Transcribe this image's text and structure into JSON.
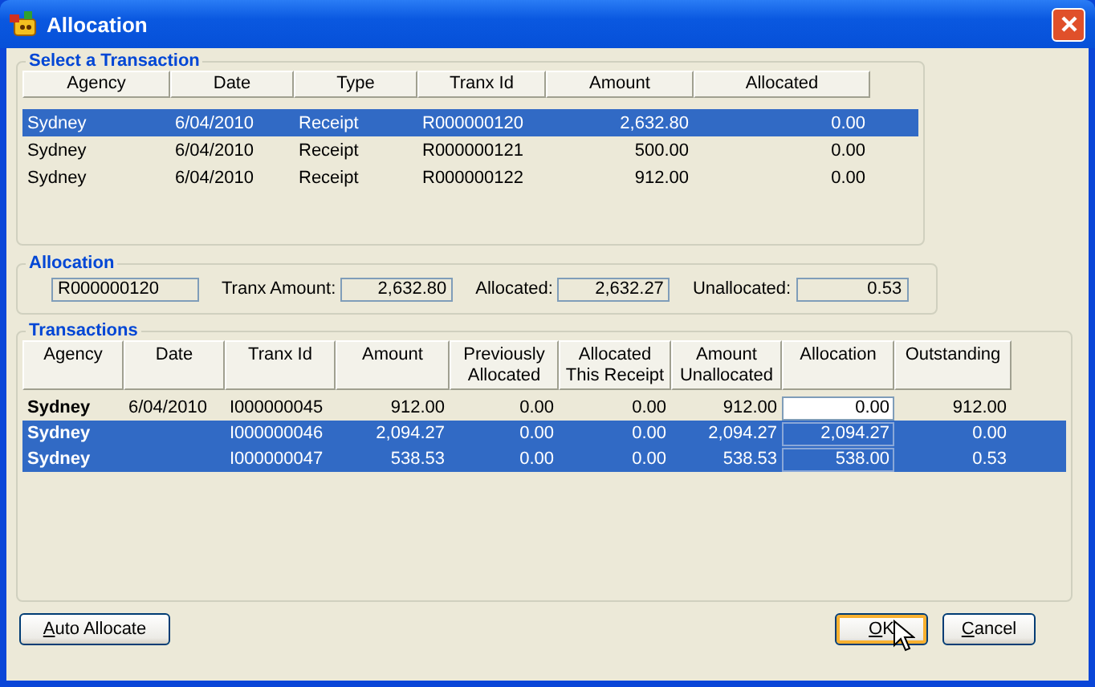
{
  "window": {
    "title": "Allocation"
  },
  "select_transaction": {
    "title": "Select a Transaction",
    "columns": [
      "Agency",
      "Date",
      "Type",
      "Tranx Id",
      "Amount",
      "Allocated"
    ],
    "rows": [
      {
        "cells": [
          "Sydney",
          "6/04/2010",
          "Receipt",
          "R000000120",
          "2,632.80",
          "0.00"
        ],
        "selected": true
      },
      {
        "cells": [
          "Sydney",
          "6/04/2010",
          "Receipt",
          "R000000121",
          "500.00",
          "0.00"
        ],
        "selected": false
      },
      {
        "cells": [
          "Sydney",
          "6/04/2010",
          "Receipt",
          "R000000122",
          "912.00",
          "0.00"
        ],
        "selected": false
      }
    ]
  },
  "allocation": {
    "title": "Allocation",
    "tranx_id": "R000000120",
    "fields": [
      {
        "label": "Tranx Amount:",
        "value": "2,632.80"
      },
      {
        "label": "Allocated:",
        "value": "2,632.27"
      },
      {
        "label": "Unallocated:",
        "value": "0.53"
      }
    ]
  },
  "transactions": {
    "title": "Transactions",
    "columns": [
      "Agency",
      "Date",
      "Tranx Id",
      "Amount",
      "Previously\nAllocated",
      "Allocated\nThis Receipt",
      "Amount\nUnallocated",
      "Allocation",
      "Outstanding"
    ],
    "rows": [
      {
        "agency": "Sydney",
        "date": "6/04/2010",
        "tranx_id": "I000000045",
        "amount": "912.00",
        "previously_allocated": "0.00",
        "allocated_this_receipt": "0.00",
        "amount_unallocated": "912.00",
        "allocation": "0.00",
        "outstanding": "912.00",
        "selected": false
      },
      {
        "agency": "Sydney",
        "tranx_id": "I000000046",
        "amount": "2,094.27",
        "previously_allocated": "0.00",
        "allocated_this_receipt": "0.00",
        "amount_unallocated": "2,094.27",
        "allocation": "2,094.27",
        "outstanding": "0.00",
        "selected": true
      },
      {
        "agency": "Sydney",
        "tranx_id": "I000000047",
        "amount": "538.53",
        "previously_allocated": "0.00",
        "allocated_this_receipt": "0.00",
        "amount_unallocated": "538.53",
        "allocation": "538.00",
        "outstanding": "0.53",
        "selected": true
      }
    ]
  },
  "buttons": [
    {
      "label": "Auto Allocate",
      "kind": "left",
      "focused": false
    },
    {
      "label": "OK",
      "kind": "right",
      "focused": true
    },
    {
      "label": "Cancel",
      "kind": "right",
      "focused": false
    }
  ]
}
